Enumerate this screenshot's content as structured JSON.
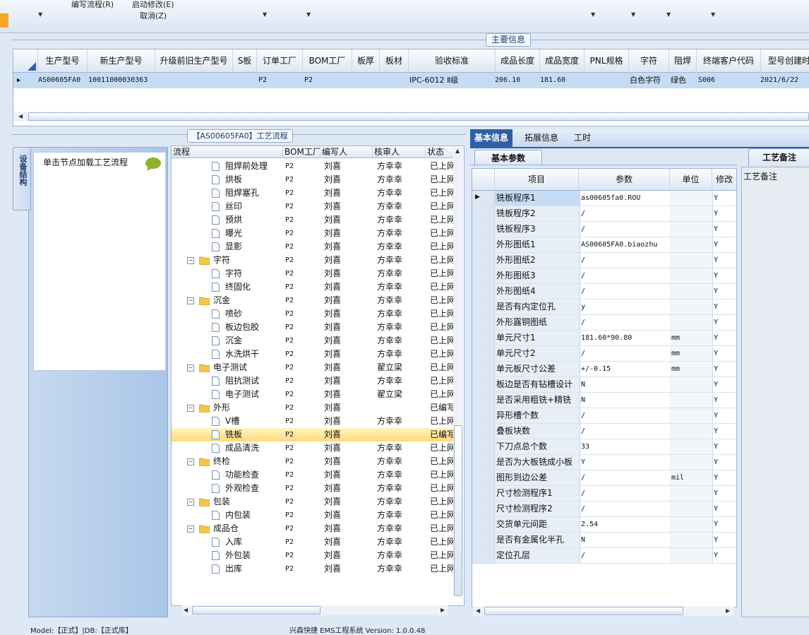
{
  "toolbar": {
    "menu1": "编写流程(R)",
    "menu2": "启动修改(E)",
    "menu3": "取消(Z)"
  },
  "main_info_title": "主要信息",
  "top_grid": {
    "columns": [
      "生产型号",
      "新生产型号",
      "升级前旧生产型号",
      "S板",
      "订单工厂",
      "BOM工厂",
      "板厚",
      "板材",
      "验收标准",
      "成品长度",
      "成品宽度",
      "PNL规格",
      "字符",
      "阻焊",
      "终端客户代码",
      "型号创建时"
    ],
    "row": {
      "prod_no": "AS00605FA0",
      "new_prod_no": "10011000030363",
      "old_prod_no": "",
      "s_board": "",
      "order_factory": "P2",
      "bom_factory": "P2",
      "thickness": "",
      "material": "",
      "standard": "IPC-6012 Ⅱ级",
      "length": "206.10",
      "width": "181.60",
      "pnl": "",
      "chars": "白色字符",
      "solder": "绿色",
      "customer_code": "S006",
      "created": "2021/6/22"
    }
  },
  "left_panel": {
    "vtab": "设备结构",
    "sidebar_title": "单击节点加载工艺流程",
    "flow_title": "【AS00605FA0】工艺流程",
    "flow_columns": [
      "流程",
      "BOM工厂",
      "编写人",
      "核审人",
      "状态"
    ],
    "rows": [
      {
        "name": "阻焊前处理",
        "level": "child",
        "bom": "P2",
        "author": "刘喜",
        "reviewer": "方幸幸",
        "status": "已上网"
      },
      {
        "name": "烘板",
        "level": "child",
        "bom": "P2",
        "author": "刘喜",
        "reviewer": "方幸幸",
        "status": "已上网"
      },
      {
        "name": "阻焊塞孔",
        "level": "child",
        "bom": "P2",
        "author": "刘喜",
        "reviewer": "方幸幸",
        "status": "已上网"
      },
      {
        "name": "丝印",
        "level": "child",
        "bom": "P2",
        "author": "刘喜",
        "reviewer": "方幸幸",
        "status": "已上网"
      },
      {
        "name": "预烘",
        "level": "child",
        "bom": "P2",
        "author": "刘喜",
        "reviewer": "方幸幸",
        "status": "已上网"
      },
      {
        "name": "曝光",
        "level": "child",
        "bom": "P2",
        "author": "刘喜",
        "reviewer": "方幸幸",
        "status": "已上网"
      },
      {
        "name": "显影",
        "level": "child",
        "bom": "P2",
        "author": "刘喜",
        "reviewer": "方幸幸",
        "status": "已上网"
      },
      {
        "name": "字符",
        "level": "group",
        "bom": "P2",
        "author": "刘喜",
        "reviewer": "方幸幸",
        "status": "已上网"
      },
      {
        "name": "字符",
        "level": "child",
        "bom": "P2",
        "author": "刘喜",
        "reviewer": "方幸幸",
        "status": "已上网"
      },
      {
        "name": "终固化",
        "level": "child",
        "bom": "P2",
        "author": "刘喜",
        "reviewer": "方幸幸",
        "status": "已上网"
      },
      {
        "name": "沉金",
        "level": "group",
        "bom": "P2",
        "author": "刘喜",
        "reviewer": "方幸幸",
        "status": "已上网"
      },
      {
        "name": "喷砂",
        "level": "child",
        "bom": "P2",
        "author": "刘喜",
        "reviewer": "方幸幸",
        "status": "已上网"
      },
      {
        "name": "板边包胶",
        "level": "child",
        "bom": "P2",
        "author": "刘喜",
        "reviewer": "方幸幸",
        "status": "已上网"
      },
      {
        "name": "沉金",
        "level": "child",
        "bom": "P2",
        "author": "刘喜",
        "reviewer": "方幸幸",
        "status": "已上网"
      },
      {
        "name": "水洗烘干",
        "level": "child",
        "bom": "P2",
        "author": "刘喜",
        "reviewer": "方幸幸",
        "status": "已上网"
      },
      {
        "name": "电子测试",
        "level": "group",
        "bom": "P2",
        "author": "刘喜",
        "reviewer": "翟立梁",
        "status": "已上网"
      },
      {
        "name": "阻抗测试",
        "level": "child",
        "bom": "P2",
        "author": "刘喜",
        "reviewer": "方幸幸",
        "status": "已上网"
      },
      {
        "name": "电子测试",
        "level": "child",
        "bom": "P2",
        "author": "刘喜",
        "reviewer": "翟立梁",
        "status": "已上网"
      },
      {
        "name": "外形",
        "level": "group",
        "bom": "P2",
        "author": "刘喜",
        "reviewer": "",
        "status": "已编写"
      },
      {
        "name": "V槽",
        "level": "child",
        "bom": "P2",
        "author": "刘喜",
        "reviewer": "方幸幸",
        "status": "已上网"
      },
      {
        "name": "铣板",
        "level": "child",
        "bom": "P2",
        "author": "刘喜",
        "reviewer": "",
        "status": "已编写",
        "selected": true
      },
      {
        "name": "成品清洗",
        "level": "child",
        "bom": "P2",
        "author": "刘喜",
        "reviewer": "方幸幸",
        "status": "已上网"
      },
      {
        "name": "终检",
        "level": "group",
        "bom": "P2",
        "author": "刘喜",
        "reviewer": "方幸幸",
        "status": "已上网"
      },
      {
        "name": "功能检查",
        "level": "child",
        "bom": "P2",
        "author": "刘喜",
        "reviewer": "方幸幸",
        "status": "已上网"
      },
      {
        "name": "外观检查",
        "level": "child",
        "bom": "P2",
        "author": "刘喜",
        "reviewer": "方幸幸",
        "status": "已上网"
      },
      {
        "name": "包装",
        "level": "group",
        "bom": "P2",
        "author": "刘喜",
        "reviewer": "方幸幸",
        "status": "已上网"
      },
      {
        "name": "内包装",
        "level": "child",
        "bom": "P2",
        "author": "刘喜",
        "reviewer": "方幸幸",
        "status": "已上网"
      },
      {
        "name": "成品仓",
        "level": "group",
        "bom": "P2",
        "author": "刘喜",
        "reviewer": "方幸幸",
        "status": "已上网"
      },
      {
        "name": "入库",
        "level": "child",
        "bom": "P2",
        "author": "刘喜",
        "reviewer": "方幸幸",
        "status": "已上网"
      },
      {
        "name": "外包装",
        "level": "child",
        "bom": "P2",
        "author": "刘喜",
        "reviewer": "方幸幸",
        "status": "已上网"
      },
      {
        "name": "出库",
        "level": "child",
        "bom": "P2",
        "author": "刘喜",
        "reviewer": "方幸幸",
        "status": "已上网"
      }
    ]
  },
  "right_panel": {
    "tabs": [
      "基本信息",
      "拓展信息",
      "工时"
    ],
    "active_tab": "基本信息",
    "sub_tab": "基本参数",
    "param_columns": [
      "项目",
      "参数",
      "单位",
      "修改"
    ],
    "params": [
      {
        "item": "铣板程序1",
        "value": "as00605fa0.ROU",
        "unit": "",
        "mod": "Y"
      },
      {
        "item": "铣板程序2",
        "value": "/",
        "unit": "",
        "mod": "Y"
      },
      {
        "item": "铣板程序3",
        "value": "/",
        "unit": "",
        "mod": "Y"
      },
      {
        "item": "外形图纸1",
        "value": "AS00605FA0.biaozhu",
        "unit": "",
        "mod": "Y"
      },
      {
        "item": "外形图纸2",
        "value": "/",
        "unit": "",
        "mod": "Y"
      },
      {
        "item": "外形图纸3",
        "value": "/",
        "unit": "",
        "mod": "Y"
      },
      {
        "item": "外形图纸4",
        "value": "/",
        "unit": "",
        "mod": "Y"
      },
      {
        "item": "是否有内定位孔",
        "value": "y",
        "unit": "",
        "mod": "Y"
      },
      {
        "item": "外形露铜图纸",
        "value": "/",
        "unit": "",
        "mod": "Y"
      },
      {
        "item": "单元尺寸1",
        "value": "181.60*90.80",
        "unit": "mm",
        "mod": "Y"
      },
      {
        "item": "单元尺寸2",
        "value": "/",
        "unit": "mm",
        "mod": "Y"
      },
      {
        "item": "单元板尺寸公差",
        "value": "+/-0.15",
        "unit": "mm",
        "mod": "Y"
      },
      {
        "item": "板边是否有钻槽设计",
        "value": "N",
        "unit": "",
        "mod": "Y"
      },
      {
        "item": "是否采用粗铣+精铣",
        "value": "N",
        "unit": "",
        "mod": "Y"
      },
      {
        "item": "异形槽个数",
        "value": "/",
        "unit": "",
        "mod": "Y"
      },
      {
        "item": "叠板块数",
        "value": "/",
        "unit": "",
        "mod": "Y"
      },
      {
        "item": "下刀点总个数",
        "value": "33",
        "unit": "",
        "mod": "Y"
      },
      {
        "item": "是否为大板铣成小板",
        "value": "Y",
        "unit": "",
        "mod": "Y"
      },
      {
        "item": "图形到边公差",
        "value": "/",
        "unit": "mil",
        "mod": "Y"
      },
      {
        "item": "尺寸检测程序1",
        "value": "/",
        "unit": "",
        "mod": "Y"
      },
      {
        "item": "尺寸检测程序2",
        "value": "/",
        "unit": "",
        "mod": "Y"
      },
      {
        "item": "交货单元间距",
        "value": "2.54",
        "unit": "",
        "mod": "Y"
      },
      {
        "item": "是否有金属化半孔",
        "value": "N",
        "unit": "",
        "mod": "Y"
      },
      {
        "item": "定位孔层",
        "value": "/",
        "unit": "",
        "mod": "Y"
      }
    ],
    "remark_tab": "工艺备注",
    "remark_label": "工艺备注"
  },
  "status_bar": {
    "left": "Model:【正式】|DB:【正式库】",
    "center": "兴森快捷 EMS工程系统 Version: 1.0.0.48"
  },
  "colors": {
    "accent": "#2f5fa6",
    "selection_row": "#ffd97a",
    "grid_selected": "#c6dcf5",
    "folder": "#f2c649"
  }
}
